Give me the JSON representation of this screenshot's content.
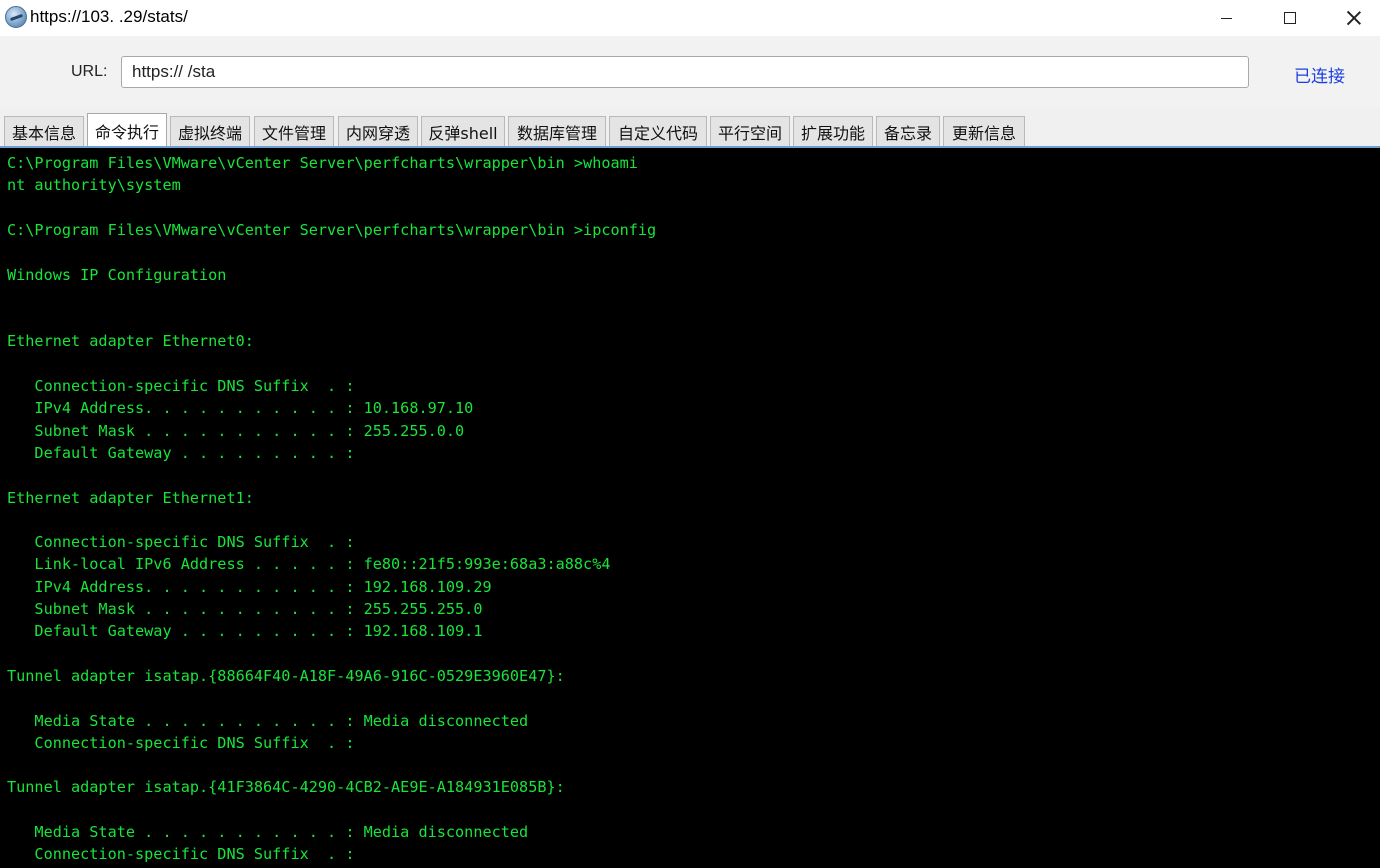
{
  "window": {
    "title": "https://103.           .29/stats/"
  },
  "urlbar": {
    "label": "URL:",
    "value": "https://             /sta",
    "status": "已连接"
  },
  "tabs": [
    {
      "label": "基本信息"
    },
    {
      "label": "命令执行"
    },
    {
      "label": "虚拟终端"
    },
    {
      "label": "文件管理"
    },
    {
      "label": "内网穿透"
    },
    {
      "label": "反弹shell"
    },
    {
      "label": "数据库管理"
    },
    {
      "label": "自定义代码"
    },
    {
      "label": "平行空间"
    },
    {
      "label": "扩展功能"
    },
    {
      "label": "备忘录"
    },
    {
      "label": "更新信息"
    }
  ],
  "active_tab": "命令执行",
  "terminal": {
    "lines": [
      "C:\\Program Files\\VMware\\vCenter Server\\perfcharts\\wrapper\\bin >whoami",
      "nt authority\\system",
      "",
      "C:\\Program Files\\VMware\\vCenter Server\\perfcharts\\wrapper\\bin >ipconfig",
      "",
      "Windows IP Configuration",
      "",
      "",
      "Ethernet adapter Ethernet0:",
      "",
      "   Connection-specific DNS Suffix  . :",
      "   IPv4 Address. . . . . . . . . . . : 10.168.97.10",
      "   Subnet Mask . . . . . . . . . . . : 255.255.0.0",
      "   Default Gateway . . . . . . . . . :",
      "",
      "Ethernet adapter Ethernet1:",
      "",
      "   Connection-specific DNS Suffix  . :",
      "   Link-local IPv6 Address . . . . . : fe80::21f5:993e:68a3:a88c%4",
      "   IPv4 Address. . . . . . . . . . . : 192.168.109.29",
      "   Subnet Mask . . . . . . . . . . . : 255.255.255.0",
      "   Default Gateway . . . . . . . . . : 192.168.109.1",
      "",
      "Tunnel adapter isatap.{88664F40-A18F-49A6-916C-0529E3960E47}:",
      "",
      "   Media State . . . . . . . . . . . : Media disconnected",
      "   Connection-specific DNS Suffix  . :",
      "",
      "Tunnel adapter isatap.{41F3864C-4290-4CB2-AE9E-A184931E085B}:",
      "",
      "   Media State . . . . . . . . . . . : Media disconnected",
      "   Connection-specific DNS Suffix  . :"
    ]
  },
  "colors": {
    "terminal_bg": "#000000",
    "terminal_fg": "#19e43a",
    "status_link": "#1a3fe0",
    "tab_accent": "#6ea0d6"
  }
}
